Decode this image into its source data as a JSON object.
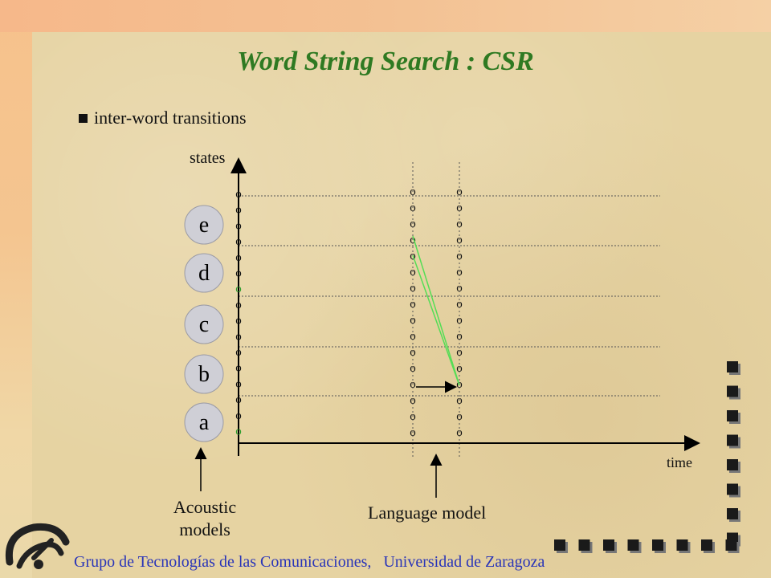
{
  "slide": {
    "title": "Word String Search : CSR",
    "bullet": "inter-word transitions",
    "footer": "Grupo de Tecnologías de las Comunicaciones,   Universidad de Zaragoza"
  },
  "diagram": {
    "y_axis_label": "states",
    "x_axis_label": "time",
    "acoustic_models_label": "Acoustic\nmodels",
    "language_model_label": "Language model",
    "models": [
      "e",
      "d",
      "c",
      "b",
      "a"
    ],
    "state_symbol": "o",
    "states_per_column": 16,
    "colors": {
      "title": "#2f7a22",
      "footer": "#2a35b8",
      "model_circle": "#cfcfd6",
      "highlight_state": "#2e9e2e",
      "transition_line": "#55dd55",
      "axis": "#000000"
    }
  }
}
